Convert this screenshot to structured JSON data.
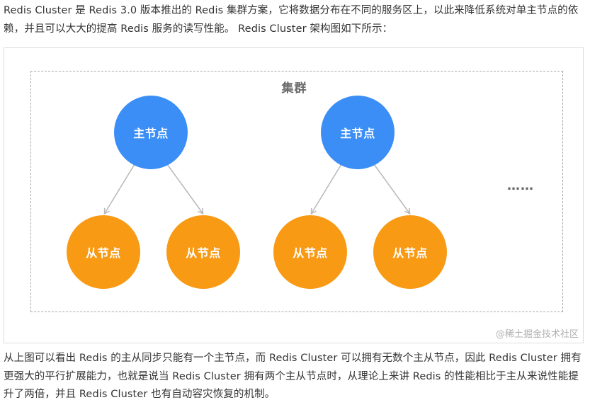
{
  "intro_text": "Redis Cluster 是 Redis 3.0 版本推出的 Redis 集群方案，它将数据分布在不同的服务区上，以此来降低系统对单主节点的依赖，并且可以大大的提高 Redis 服务的读写性能。 Redis Cluster 架构图如下所示：",
  "figure": {
    "cluster_label": "集群",
    "master_label": "主节点",
    "slave_label": "从节点",
    "ellipsis": "……",
    "watermark": "@稀土掘金技术社区",
    "colors": {
      "master": "#3a8ef6",
      "slave": "#f89a14",
      "arrow": "#b8b8b8",
      "frame": "#a8a8a8"
    }
  },
  "conclusion_text": "从上图可以看出 Redis 的主从同步只能有一个主节点，而 Redis Cluster 可以拥有无数个主从节点，因此 Redis Cluster 拥有更强大的平行扩展能力，也就是说当 Redis Cluster 拥有两个主从节点时，从理论上来讲 Redis 的性能相比于主从来说性能提升了两倍，并且 Redis Cluster 也有自动容灾恢复的机制。"
}
